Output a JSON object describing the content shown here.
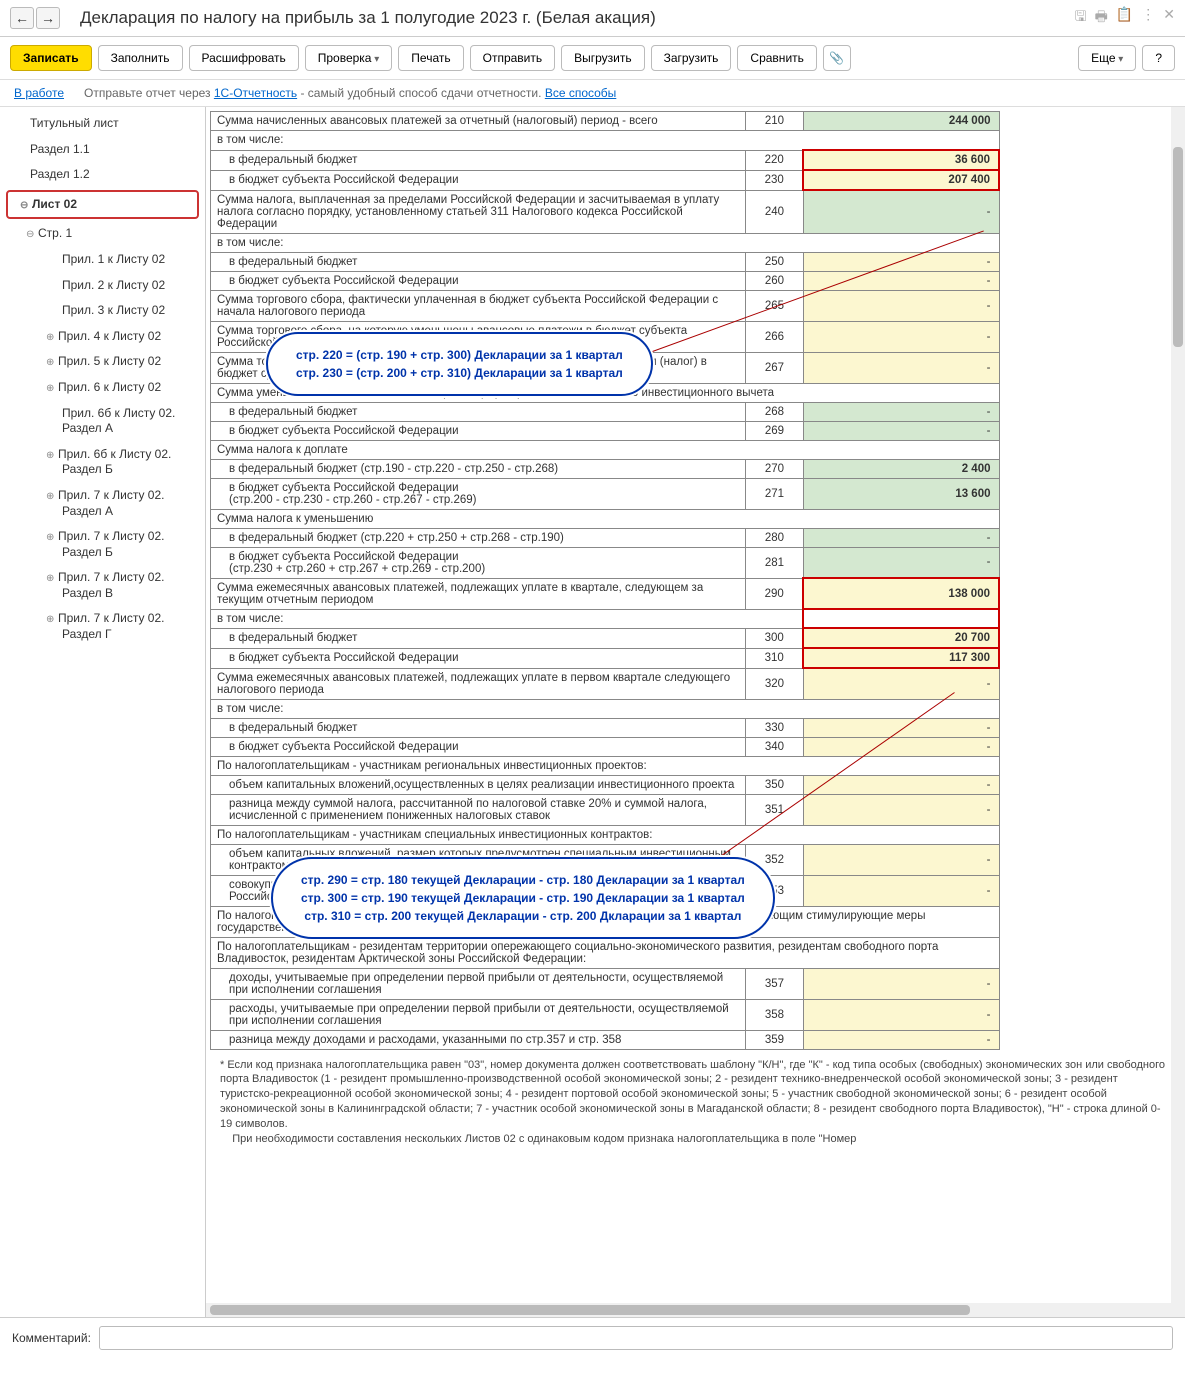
{
  "title": "Декларация по налогу на прибыль за 1 полугодие 2023 г. (Белая акация)",
  "toolbar": {
    "write": "Записать",
    "fill": "Заполнить",
    "decode": "Расшифровать",
    "check": "Проверка",
    "print": "Печать",
    "send": "Отправить",
    "upload": "Выгрузить",
    "download": "Загрузить",
    "compare": "Сравнить",
    "more": "Еще",
    "help": "?"
  },
  "status": {
    "label": "В работе",
    "text1": "Отправьте отчет через ",
    "link1": "1С-Отчетность",
    "text2": " - самый удобный способ сдачи отчетности. ",
    "link2": "Все способы"
  },
  "tree": [
    {
      "label": "Титульный лист",
      "level": 0
    },
    {
      "label": "Раздел 1.1",
      "level": 0
    },
    {
      "label": "Раздел 1.2",
      "level": 0
    },
    {
      "label": "Лист 02",
      "level": 0,
      "selected": true,
      "exp": "-"
    },
    {
      "label": "Стр. 1",
      "level": 1,
      "exp": "-"
    },
    {
      "label": "Прил. 1 к Листу 02",
      "level": 2
    },
    {
      "label": "Прил. 2 к Листу 02",
      "level": 2
    },
    {
      "label": "Прил. 3 к Листу 02",
      "level": 2
    },
    {
      "label": "Прил. 4 к Листу 02",
      "level": 2,
      "exp": "+"
    },
    {
      "label": "Прил. 5 к Листу 02",
      "level": 2,
      "exp": "+"
    },
    {
      "label": "Прил. 6 к Листу 02",
      "level": 2,
      "exp": "+"
    },
    {
      "label": "Прил. 6б к Листу 02. Раздел А",
      "level": 2
    },
    {
      "label": "Прил. 6б к Листу 02. Раздел Б",
      "level": 2,
      "exp": "+"
    },
    {
      "label": "Прил. 7 к Листу 02. Раздел А",
      "level": 2,
      "exp": "+"
    },
    {
      "label": "Прил. 7 к Листу 02. Раздел Б",
      "level": 2,
      "exp": "+"
    },
    {
      "label": "Прил. 7 к Листу 02. Раздел В",
      "level": 2,
      "exp": "+"
    },
    {
      "label": "Прил. 7 к Листу 02. Раздел Г",
      "level": 2,
      "exp": "+"
    }
  ],
  "rows": [
    {
      "desc": "Сумма начисленных авансовых платежей за отчетный (налоговый) период - всего",
      "code": "210",
      "val": "244 000",
      "bg": "green",
      "bold": true
    },
    {
      "desc": "в том числе:",
      "section": true
    },
    {
      "desc": "в федеральный бюджет",
      "code": "220",
      "val": "36 600",
      "bg": "yellow",
      "indent": true,
      "red": true,
      "bold": true
    },
    {
      "desc": "в бюджет субъекта Российской Федерации",
      "code": "230",
      "val": "207 400",
      "bg": "yellow",
      "indent": true,
      "red": true,
      "bold": true
    },
    {
      "desc": "Сумма налога, выплаченная за пределами Российской Федерации и засчитываемая в уплату налога согласно порядку, установленному статьей 311 Налогового кодекса Российской Федерации",
      "code": "240",
      "val": "-",
      "bg": "green"
    },
    {
      "desc": "в том числе:",
      "section": true
    },
    {
      "desc": "в федеральный бюджет",
      "code": "250",
      "val": "-",
      "bg": "yellow",
      "indent": true
    },
    {
      "desc": "в бюджет субъекта Российской Федерации",
      "code": "260",
      "val": "-",
      "bg": "yellow",
      "indent": true
    },
    {
      "desc": "Сумма торгового сбора, фактически уплаченная в бюджет субъекта Российской Федерации с начала налогового периода",
      "code": "265",
      "val": "-",
      "bg": "yellow"
    },
    {
      "desc": "Сумма торгового сбора, на которую уменьшены авансовые платежи в бюджет субъекта Российской Федерации за предыдущий отчетный период",
      "code": "266",
      "val": "-",
      "bg": "yellow"
    },
    {
      "desc": "Сумма торгового сбора, на которую уменьшены исчисленные авансовые платежи (налог) в бюджет субъекта Российской Федерации за отчетный (налоговый) период",
      "code": "267",
      "val": "-",
      "bg": "yellow"
    },
    {
      "desc": "Сумма уменьшения авансовых платежей (налога) при применении налогового инвестиционного вычета",
      "section": true
    },
    {
      "desc": "в федеральный бюджет",
      "code": "268",
      "val": "-",
      "bg": "green",
      "indent": true
    },
    {
      "desc": "в бюджет субъекта Российской Федерации",
      "code": "269",
      "val": "-",
      "bg": "green",
      "indent": true
    },
    {
      "desc": "Сумма налога к доплате",
      "section": true
    },
    {
      "desc": "в федеральный бюджет (стр.190 - стр.220 - стр.250 - стр.268)",
      "code": "270",
      "val": "2 400",
      "bg": "green",
      "indent": true,
      "bold": true
    },
    {
      "desc": "в бюджет субъекта Российской Федерации\n(стр.200 - стр.230 - стр.260 - стр.267 - стр.269)",
      "code": "271",
      "val": "13 600",
      "bg": "green",
      "indent": true,
      "bold": true
    },
    {
      "desc": "Сумма налога к уменьшению",
      "section": true
    },
    {
      "desc": "в федеральный бюджет (стр.220 + стр.250 + стр.268 - стр.190)",
      "code": "280",
      "val": "-",
      "bg": "green",
      "indent": true
    },
    {
      "desc": "в бюджет субъекта Российской Федерации\n(стр.230 + стр.260 + стр.267 + стр.269 - стр.200)",
      "code": "281",
      "val": "-",
      "bg": "green",
      "indent": true
    },
    {
      "desc": "Сумма ежемесячных авансовых платежей, подлежащих уплате в квартале, следующем за текущим отчетным периодом",
      "code": "290",
      "val": "138 000",
      "bg": "yellow",
      "red": true,
      "bold": true
    },
    {
      "desc": "в том числе:",
      "section": true,
      "redcell": true
    },
    {
      "desc": "в федеральный бюджет",
      "code": "300",
      "val": "20 700",
      "bg": "yellow",
      "indent": true,
      "red": true,
      "bold": true
    },
    {
      "desc": "в бюджет субъекта Российской Федерации",
      "code": "310",
      "val": "117 300",
      "bg": "yellow",
      "indent": true,
      "red": true,
      "bold": true
    },
    {
      "desc": "Сумма ежемесячных авансовых платежей, подлежащих уплате в первом квартале следующего налогового периода",
      "code": "320",
      "val": "-",
      "bg": "yellow"
    },
    {
      "desc": "в том числе:",
      "section": true
    },
    {
      "desc": "в федеральный бюджет",
      "code": "330",
      "val": "-",
      "bg": "yellow",
      "indent": true
    },
    {
      "desc": "в бюджет субъекта Российской Федерации",
      "code": "340",
      "val": "-",
      "bg": "yellow",
      "indent": true
    },
    {
      "desc": "По налогоплательщикам - участникам региональных инвестиционных проектов:",
      "section": true
    },
    {
      "desc": "объем капитальных вложений,осуществленных в целях реализации инвестиционного проекта",
      "code": "350",
      "val": "-",
      "bg": "yellow",
      "indent": true
    },
    {
      "desc": "разница между суммой налога, рассчитанной по налоговой ставке 20% и суммой налога, исчисленной с применением пониженных налоговых ставок",
      "code": "351",
      "val": "-",
      "bg": "yellow",
      "indent": true
    },
    {
      "desc": "По налогоплательщикам - участникам специальных инвестиционных контрактов:",
      "section": true
    },
    {
      "desc": "объем капитальных вложений, размер которых предусмотрен специальным инвестиционным контрактом",
      "code": "352",
      "val": "-",
      "bg": "yellow",
      "indent": true
    },
    {
      "desc": "совокупный объем расходов и недополученных доходов бюджетов бюджетной системы Российской Федерации",
      "code": "353",
      "val": "-",
      "bg": "yellow",
      "indent": true
    },
    {
      "desc": "По налогоплательщикам - участникам соглашений о защите и поощрении капиталовложений, применяющим стимулирующие меры государственной поддержки и реализации инвестиционного проекта",
      "section": true
    },
    {
      "desc": "По налогоплательщикам - резидентам территории опережающего социально-экономического развития, резидентам свободного порта Владивосток, резидентам Арктической зоны Российской Федерации:",
      "section": true
    },
    {
      "desc": "доходы, учитываемые при определении первой прибыли от деятельности, осуществляемой при исполнении соглашения",
      "code": "357",
      "val": "-",
      "bg": "yellow",
      "indent": true
    },
    {
      "desc": "расходы, учитываемые при определении первой прибыли от деятельности, осуществляемой при исполнении соглашения",
      "code": "358",
      "val": "-",
      "bg": "yellow",
      "indent": true
    },
    {
      "desc": "разница между доходами и расходами, указанными по стр.357 и стр. 358",
      "code": "359",
      "val": "-",
      "bg": "yellow",
      "indent": true
    }
  ],
  "footnote": "* Если код признака налогоплательщика равен \"03\", номер документа должен соответствовать шаблону \"К/Н\", где \"К\" - код типа особых (свободных) экономических зон или свободного порта Владивосток (1 - резидент промышленно-производственной особой экономической зоны; 2 - резидент технико-внедренческой особой экономической зоны; 3 - резидент туристско-рекреационной особой экономической зоны; 4 - резидент портовой особой экономической зоны; 5 - участник свободной экономической зоны; 6 - резидент особой экономической зоны в Калининградской области; 7 - участник особой экономической зоны в Магаданской области; 8 - резидент свободного порта Владивосток), \"Н\" - строка длиной 0-19 символов.\n    При необходимости составления нескольких Листов 02 с одинаковым кодом признака налогоплательщика в поле \"Номер",
  "callout1": {
    "line1": "стр. 220 = (стр. 190 + стр. 300) Декларации за 1 квартал",
    "line2": "стр. 230 = (стр. 200 + стр. 310) Декларации за 1 квартал"
  },
  "callout2": {
    "line1": "стр. 290 = стр. 180 текущей Декларации - стр. 180 Декларации за 1 квартал",
    "line2": "стр. 300 = стр. 190 текущей Декларации - стр. 190 Декларации за 1 квартал",
    "line3": "стр. 310 = стр. 200 текущей Декларации - стр. 200 Дкларации за 1 квартал"
  },
  "comment_label": "Комментарий:"
}
